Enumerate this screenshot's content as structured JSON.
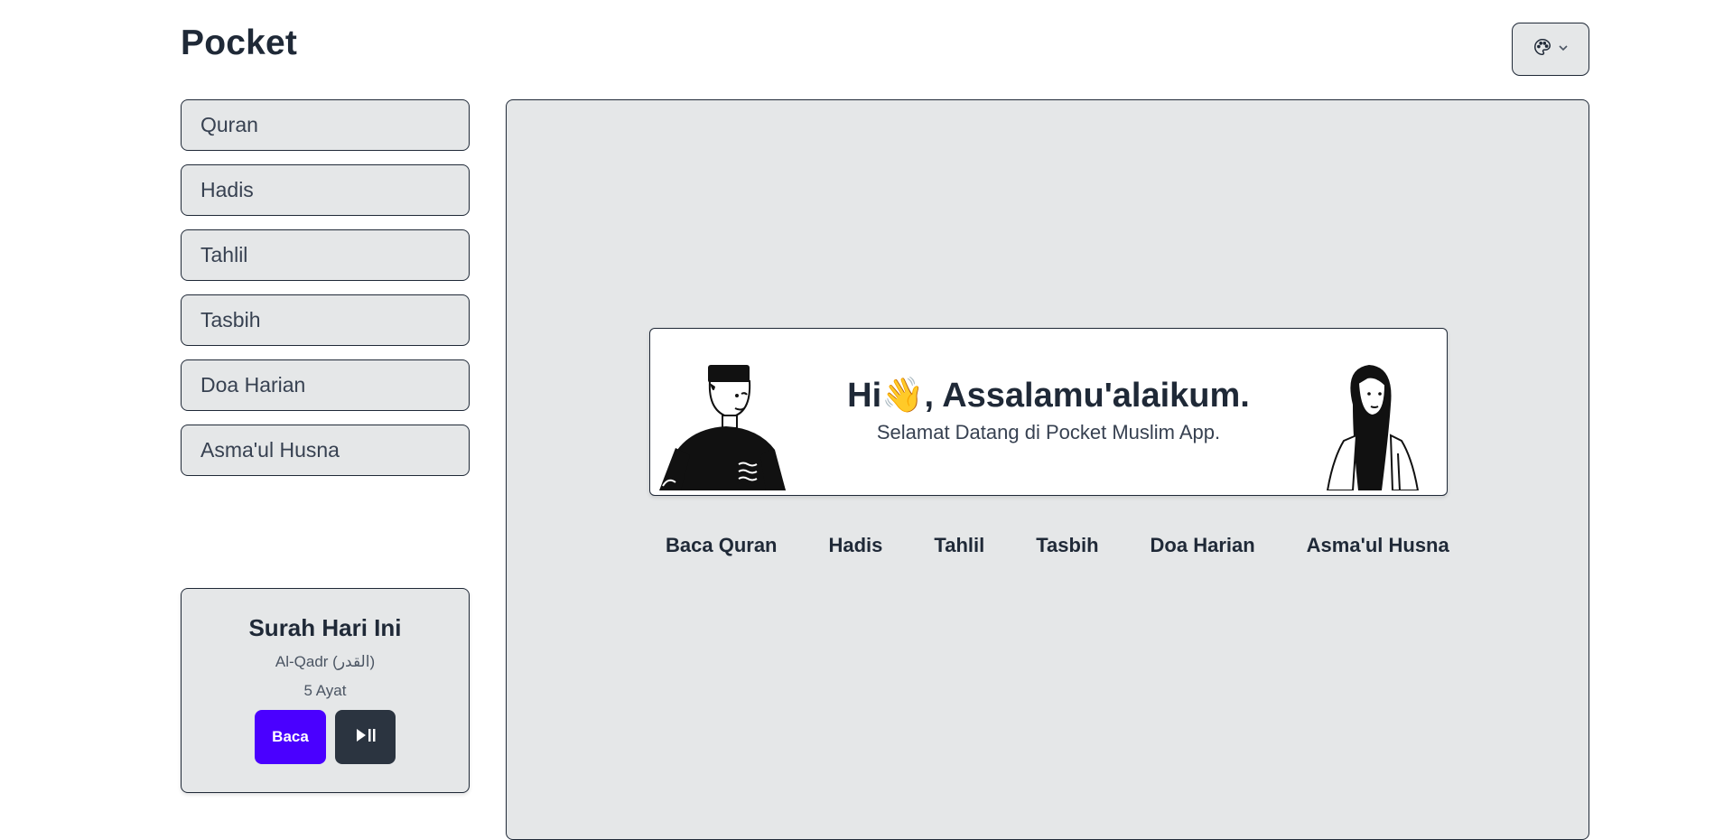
{
  "app": {
    "title": "Pocket"
  },
  "header": {
    "theme_icon": "palette-icon",
    "dropdown_icon": "chevron-down-icon"
  },
  "sidebar": {
    "items": [
      {
        "label": "Quran"
      },
      {
        "label": "Hadis"
      },
      {
        "label": "Tahlil"
      },
      {
        "label": "Tasbih"
      },
      {
        "label": "Doa Harian"
      },
      {
        "label": "Asma'ul Husna"
      }
    ]
  },
  "surah_card": {
    "title": "Surah Hari Ini",
    "name": "Al-Qadr (القدر)",
    "ayat": "5 Ayat",
    "read_label": "Baca",
    "play_icon": "play-pause-icon"
  },
  "hero": {
    "greeting": "Hi",
    "wave_emoji": "👋",
    "greeting_rest": ", Assalamu'alaikum.",
    "subtitle": "Selamat Datang di Pocket Muslim App."
  },
  "quick_links": [
    {
      "label": "Baca Quran"
    },
    {
      "label": "Hadis"
    },
    {
      "label": "Tahlil"
    },
    {
      "label": "Tasbih"
    },
    {
      "label": "Doa Harian"
    },
    {
      "label": "Asma'ul Husna"
    }
  ],
  "colors": {
    "primary": "#4a00ff",
    "neutral": "#2b3440",
    "panel_bg": "#e5e7e8",
    "text": "#1f2937"
  }
}
